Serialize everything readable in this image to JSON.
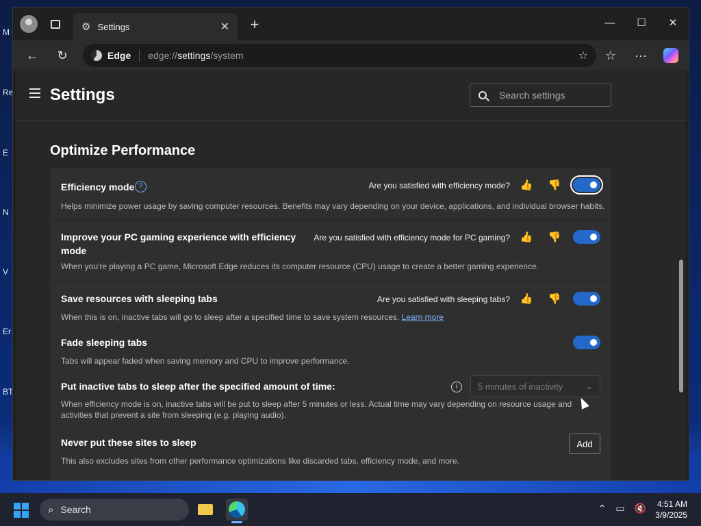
{
  "desktop": {
    "side_labels": [
      "M",
      "Re",
      "E",
      "N",
      "V",
      "Er",
      "BT"
    ]
  },
  "browser": {
    "tab_title": "Settings",
    "address_brand": "Edge",
    "address_url_prefix": "edge://",
    "address_url_highlight": "settings",
    "address_url_suffix": "/system"
  },
  "settings": {
    "title": "Settings",
    "search_placeholder": "Search settings",
    "section_title": "Optimize Performance",
    "efficiency": {
      "title": "Efficiency mode",
      "question": "Are you satisfied with efficiency mode?",
      "description": "Helps minimize power usage by saving computer resources. Benefits may vary depending on your device, applications, and individual browser habits.",
      "enabled": true
    },
    "gaming": {
      "title_line1": "Improve your PC gaming experience with efficiency",
      "title_line2": "mode",
      "question": "Are you satisfied with efficiency mode for PC gaming?",
      "description": "When you're playing a PC game, Microsoft Edge reduces its computer resource (CPU) usage to create a better gaming experience.",
      "enabled": true
    },
    "sleeping": {
      "title": "Save resources with sleeping tabs",
      "question": "Are you satisfied with sleeping tabs?",
      "description": "When this is on, inactive tabs will go to sleep after a specified time to save system resources.",
      "learn_more": "Learn more",
      "enabled": true
    },
    "fade": {
      "title": "Fade sleeping tabs",
      "description": "Tabs will appear faded when saving memory and CPU to improve performance.",
      "enabled": true
    },
    "inactive": {
      "title": "Put inactive tabs to sleep after the specified amount of time:",
      "dropdown_value": "5 minutes of inactivity",
      "description_line1": "When efficiency mode is on, inactive tabs will be put to sleep after 5 minutes or less. Actual time may vary depending on resource usage and",
      "description_line2": "activities that prevent a site from sleeping (e.g. playing audio)."
    },
    "never_sleep": {
      "title": "Never put these sites to sleep",
      "add_label": "Add",
      "description": "This also excludes sites from other performance optimizations like discarded tabs, efficiency mode, and more."
    }
  },
  "taskbar": {
    "search_label": "Search",
    "time": "4:51 AM",
    "date": "3/9/2025"
  },
  "colors": {
    "accent": "#2469c9",
    "link": "#7fb5ff"
  }
}
